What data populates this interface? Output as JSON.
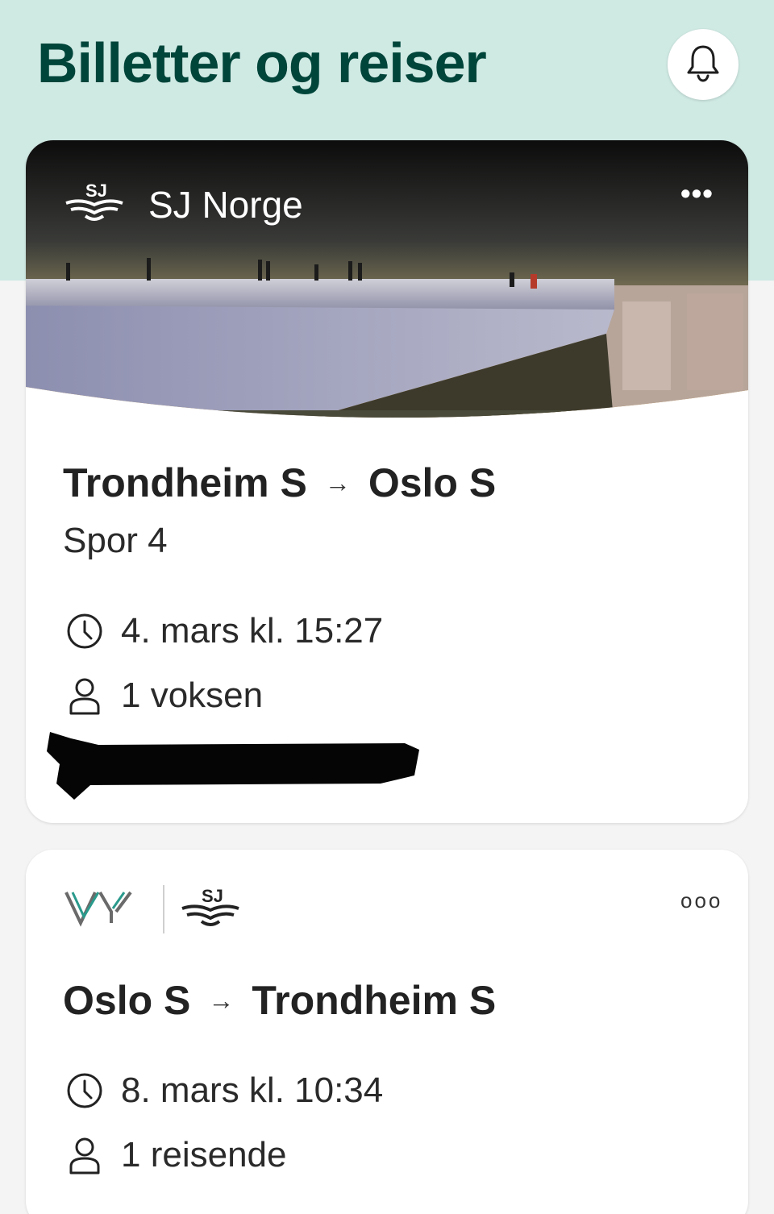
{
  "header": {
    "title": "Billetter og reiser",
    "bell_icon": "bell-icon"
  },
  "trips": [
    {
      "operator": "SJ Norge",
      "from": "Trondheim S",
      "arrow": "→",
      "to": "Oslo S",
      "platform": "Spor 4",
      "datetime": "4. mars kl. 15:27",
      "passengers": "1 voksen",
      "more": "•••"
    },
    {
      "operators": [
        "Vy",
        "SJ"
      ],
      "from": "Oslo S",
      "arrow": "→",
      "to": "Trondheim S",
      "datetime": "8. mars kl. 10:34",
      "passengers": "1 reisende",
      "more": "ooo"
    }
  ],
  "colors": {
    "header_bg": "#cfe9e3",
    "title": "#00453a",
    "page_bg": "#f4f4f4",
    "card_bg": "#ffffff"
  }
}
